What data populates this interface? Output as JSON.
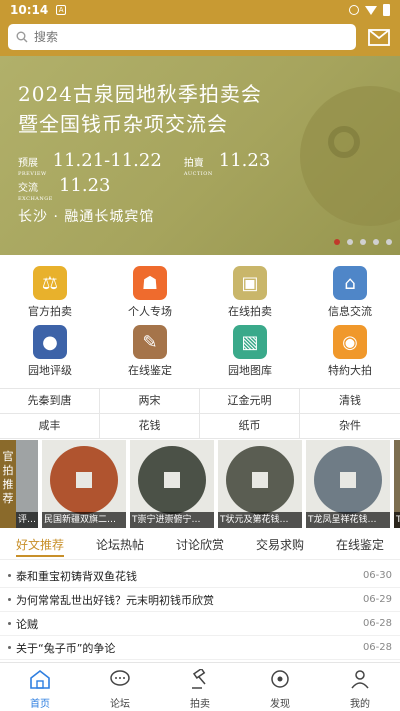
{
  "status_bar": {
    "time": "10:14"
  },
  "search": {
    "placeholder": "搜索"
  },
  "banner": {
    "title_line1": "2024古泉园地秋季拍卖会",
    "title_line2": "暨全国钱币杂项交流会",
    "preview_label": "预展",
    "preview_label_en": "PREVIEW",
    "preview_dates": "11.21-11.22",
    "auction_label": "拍賣",
    "auction_label_en": "AUCTION",
    "auction_date": "11.23",
    "exchange_label": "交流",
    "exchange_label_en": "EXCHANGE",
    "exchange_date": "11.23",
    "venue": "长沙 · 融通长城宾馆",
    "slide_count": 5,
    "active_slide": 1
  },
  "grid": [
    {
      "label": "官方拍卖",
      "icon": "gavel-icon",
      "color": "#e8b12c"
    },
    {
      "label": "个人专场",
      "icon": "personal-auction-icon",
      "color": "#ef6b2d"
    },
    {
      "label": "在线拍卖",
      "icon": "online-auction-icon",
      "color": "#c9b66a"
    },
    {
      "label": "信息交流",
      "icon": "shop-icon",
      "color": "#4f86c8"
    },
    {
      "label": "园地评级",
      "icon": "badge-icon",
      "color": "#3d63a8"
    },
    {
      "label": "在线鉴定",
      "icon": "stamp-icon",
      "color": "#a5744a"
    },
    {
      "label": "园地图库",
      "icon": "gallery-icon",
      "color": "#3aa98a"
    },
    {
      "label": "特約大拍",
      "icon": "broadcast-icon",
      "color": "#f0982b"
    }
  ],
  "categories": [
    [
      "先秦到唐",
      "两宋",
      "辽金元明",
      "清钱"
    ],
    [
      "咸丰",
      "花钱",
      "纸币",
      "杂件"
    ]
  ],
  "recommend": {
    "tag": "官拍推荐",
    "items": [
      {
        "caption": "评…",
        "partial": true,
        "color": "#9fa3a4"
      },
      {
        "caption": "民国新疆双旗二…",
        "color": "#b0542f"
      },
      {
        "caption": "T崇宁进崇俯宁…",
        "color": "#4b5147"
      },
      {
        "caption": "T状元及第花钱…",
        "color": "#5a5d52"
      },
      {
        "caption": "T龙凤呈祥花钱…",
        "color": "#6f7c86"
      },
      {
        "caption": "T",
        "partial": true,
        "color": "#7d6e50"
      }
    ]
  },
  "tabs": [
    "好文推荐",
    "论坛热帖",
    "讨论欣赏",
    "交易求购",
    "在线鉴定"
  ],
  "articles": [
    {
      "title": "泰和重宝初铸背双鱼花钱",
      "date": "06-30"
    },
    {
      "title": "为何常常乱世出好钱？元末明初钱币欣赏",
      "date": "06-29"
    },
    {
      "title": "论贼",
      "date": "06-28"
    },
    {
      "title": "关于“兔子币”的争论",
      "date": "06-28"
    }
  ],
  "nav": [
    {
      "label": "首页",
      "icon": "home-icon"
    },
    {
      "label": "论坛",
      "icon": "chat-icon"
    },
    {
      "label": "拍卖",
      "icon": "auction-icon"
    },
    {
      "label": "发现",
      "icon": "discover-icon"
    },
    {
      "label": "我的",
      "icon": "user-icon"
    }
  ],
  "colors": {
    "header": "#c89a33",
    "accent": "#c8902a",
    "nav_active": "#2f7fe0"
  }
}
